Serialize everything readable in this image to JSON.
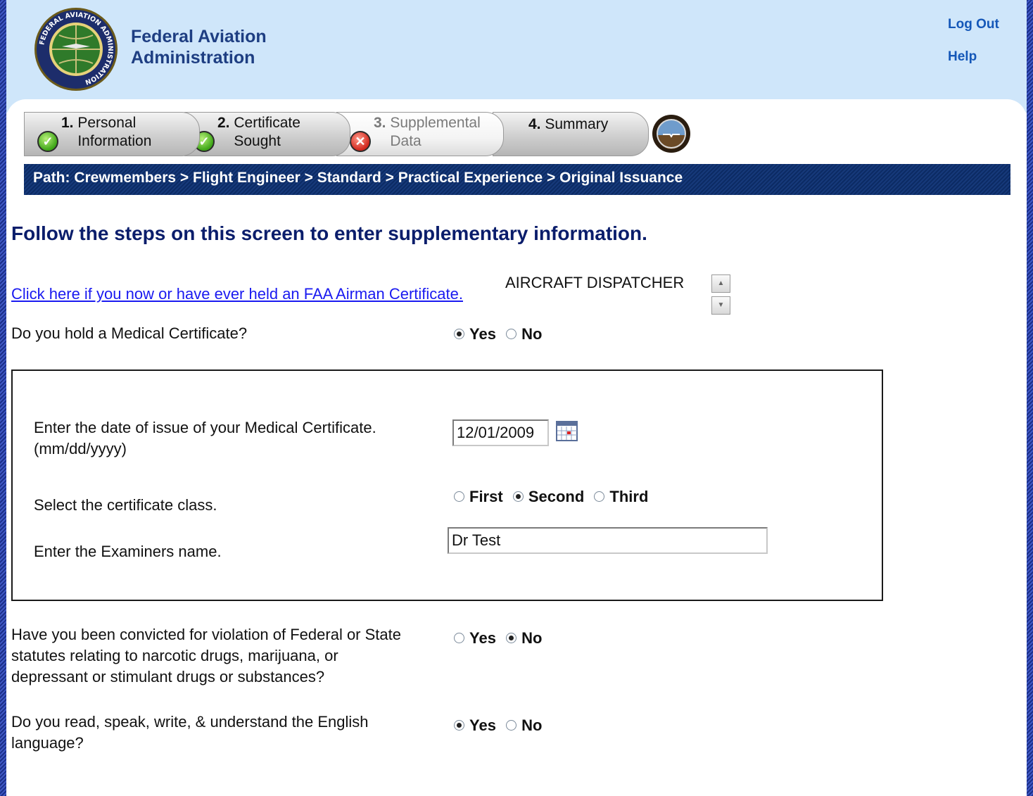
{
  "header": {
    "org_line1": "Federal Aviation",
    "org_line2": "Administration",
    "seal_text": "FEDERAL AVIATION ADMINISTRATION",
    "logout_label": "Log Out",
    "help_label": "Help"
  },
  "wizard": {
    "steps": [
      {
        "num": "1.",
        "line1": "Personal",
        "line2": "Information",
        "status": "complete",
        "icon": "check-icon"
      },
      {
        "num": "2.",
        "line1": "Certificate",
        "line2": "Sought",
        "status": "complete",
        "icon": "check-icon"
      },
      {
        "num": "3.",
        "line1": "Supplemental",
        "line2": "Data",
        "status": "error",
        "icon": "error-icon"
      },
      {
        "num": "4.",
        "line1": "Summary",
        "line2": "",
        "status": "pending",
        "icon": ""
      }
    ]
  },
  "path": {
    "text": "Path: Crewmembers > Flight Engineer > Standard > Practical Experience > Original Issuance"
  },
  "main": {
    "heading": "Follow the steps on this screen to enter supplementary information.",
    "airman_link": "Click here if you now or have ever held an FAA Airman Certificate.",
    "held_certificates": [
      "AIRCRAFT DISPATCHER"
    ],
    "medical_question": "Do you hold a Medical Certificate?",
    "medical_answer": "Yes",
    "yes_label": "Yes",
    "no_label": "No",
    "medical_box": {
      "date_label_line1": "Enter the date of issue of your Medical Certificate.",
      "date_label_line2": "(mm/dd/yyyy)",
      "date_value": "12/01/2009",
      "class_label": "Select the certificate class.",
      "class_options": [
        "First",
        "Second",
        "Third"
      ],
      "class_selected": "Second",
      "examiner_label": "Enter the Examiners name.",
      "examiner_value": "Dr Test"
    },
    "drug_question_lines": [
      "Have you been convicted for violation of Federal or State",
      "statutes relating to narcotic drugs, marijuana, or",
      "depressant or stimulant drugs or substances?"
    ],
    "drug_answer": "No",
    "english_question_lines": [
      "Do you read, speak, write, & understand the English",
      "language?"
    ],
    "english_answer": "Yes"
  },
  "colors": {
    "header_bg": "#cfe6fa",
    "path_bar": "#0c2b64",
    "heading": "#0a1d6b",
    "link": "#1a1af0",
    "toplink": "#1457b8"
  }
}
